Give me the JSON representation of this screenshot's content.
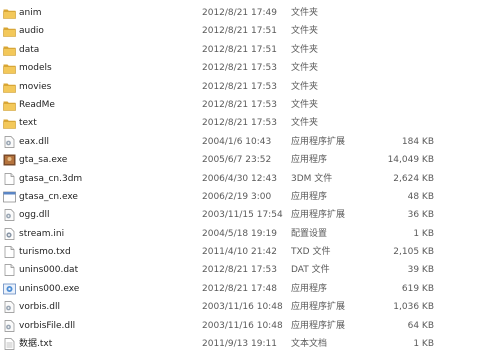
{
  "files": [
    {
      "name": "anim",
      "date": "2012/8/21 17:49",
      "type": "文件夹",
      "size": "",
      "icon": "folder-icon"
    },
    {
      "name": "audio",
      "date": "2012/8/21 17:51",
      "type": "文件夹",
      "size": "",
      "icon": "folder-icon"
    },
    {
      "name": "data",
      "date": "2012/8/21 17:51",
      "type": "文件夹",
      "size": "",
      "icon": "folder-icon"
    },
    {
      "name": "models",
      "date": "2012/8/21 17:53",
      "type": "文件夹",
      "size": "",
      "icon": "folder-icon"
    },
    {
      "name": "movies",
      "date": "2012/8/21 17:53",
      "type": "文件夹",
      "size": "",
      "icon": "folder-icon"
    },
    {
      "name": "ReadMe",
      "date": "2012/8/21 17:53",
      "type": "文件夹",
      "size": "",
      "icon": "folder-icon"
    },
    {
      "name": "text",
      "date": "2012/8/21 17:53",
      "type": "文件夹",
      "size": "",
      "icon": "folder-icon"
    },
    {
      "name": "eax.dll",
      "date": "2004/1/6 10:43",
      "type": "应用程序扩展",
      "size": "184 KB",
      "icon": "dll-icon"
    },
    {
      "name": "gta_sa.exe",
      "date": "2005/6/7 23:52",
      "type": "应用程序",
      "size": "14,049 KB",
      "icon": "game-exe-icon"
    },
    {
      "name": "gtasa_cn.3dm",
      "date": "2006/4/30 12:43",
      "type": "3DM 文件",
      "size": "2,624 KB",
      "icon": "file-icon"
    },
    {
      "name": "gtasa_cn.exe",
      "date": "2006/2/19 3:00",
      "type": "应用程序",
      "size": "48 KB",
      "icon": "exe-icon"
    },
    {
      "name": "ogg.dll",
      "date": "2003/11/15 17:54",
      "type": "应用程序扩展",
      "size": "36 KB",
      "icon": "dll-icon"
    },
    {
      "name": "stream.ini",
      "date": "2004/5/18 19:19",
      "type": "配置设置",
      "size": "1 KB",
      "icon": "ini-icon"
    },
    {
      "name": "turismo.txd",
      "date": "2011/4/10 21:42",
      "type": "TXD 文件",
      "size": "2,105 KB",
      "icon": "file-icon"
    },
    {
      "name": "unins000.dat",
      "date": "2012/8/21 17:53",
      "type": "DAT 文件",
      "size": "39 KB",
      "icon": "file-icon"
    },
    {
      "name": "unins000.exe",
      "date": "2012/8/21 17:48",
      "type": "应用程序",
      "size": "619 KB",
      "icon": "installer-icon"
    },
    {
      "name": "vorbis.dll",
      "date": "2003/11/16 10:48",
      "type": "应用程序扩展",
      "size": "1,036 KB",
      "icon": "dll-icon"
    },
    {
      "name": "vorbisFile.dll",
      "date": "2003/11/16 10:48",
      "type": "应用程序扩展",
      "size": "64 KB",
      "icon": "dll-icon"
    },
    {
      "name": "数据.txt",
      "date": "2011/9/13 19:11",
      "type": "文本文档",
      "size": "1 KB",
      "icon": "text-file-icon"
    }
  ],
  "colors": {
    "folder": "#f3c85a",
    "folder_dark": "#d9a531",
    "text_primary": "#1f1f1f",
    "text_secondary": "#5a5a5a"
  }
}
